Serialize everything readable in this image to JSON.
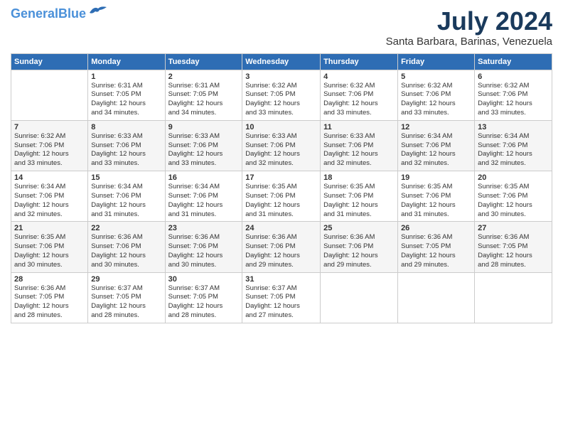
{
  "header": {
    "logo_general": "General",
    "logo_blue": "Blue",
    "month": "July 2024",
    "location": "Santa Barbara, Barinas, Venezuela"
  },
  "days_of_week": [
    "Sunday",
    "Monday",
    "Tuesday",
    "Wednesday",
    "Thursday",
    "Friday",
    "Saturday"
  ],
  "weeks": [
    [
      {
        "day": "",
        "info": ""
      },
      {
        "day": "1",
        "info": "Sunrise: 6:31 AM\nSunset: 7:05 PM\nDaylight: 12 hours\nand 34 minutes."
      },
      {
        "day": "2",
        "info": "Sunrise: 6:31 AM\nSunset: 7:05 PM\nDaylight: 12 hours\nand 34 minutes."
      },
      {
        "day": "3",
        "info": "Sunrise: 6:32 AM\nSunset: 7:05 PM\nDaylight: 12 hours\nand 33 minutes."
      },
      {
        "day": "4",
        "info": "Sunrise: 6:32 AM\nSunset: 7:06 PM\nDaylight: 12 hours\nand 33 minutes."
      },
      {
        "day": "5",
        "info": "Sunrise: 6:32 AM\nSunset: 7:06 PM\nDaylight: 12 hours\nand 33 minutes."
      },
      {
        "day": "6",
        "info": "Sunrise: 6:32 AM\nSunset: 7:06 PM\nDaylight: 12 hours\nand 33 minutes."
      }
    ],
    [
      {
        "day": "7",
        "info": "Sunrise: 6:32 AM\nSunset: 7:06 PM\nDaylight: 12 hours\nand 33 minutes."
      },
      {
        "day": "8",
        "info": "Sunrise: 6:33 AM\nSunset: 7:06 PM\nDaylight: 12 hours\nand 33 minutes."
      },
      {
        "day": "9",
        "info": "Sunrise: 6:33 AM\nSunset: 7:06 PM\nDaylight: 12 hours\nand 33 minutes."
      },
      {
        "day": "10",
        "info": "Sunrise: 6:33 AM\nSunset: 7:06 PM\nDaylight: 12 hours\nand 32 minutes."
      },
      {
        "day": "11",
        "info": "Sunrise: 6:33 AM\nSunset: 7:06 PM\nDaylight: 12 hours\nand 32 minutes."
      },
      {
        "day": "12",
        "info": "Sunrise: 6:34 AM\nSunset: 7:06 PM\nDaylight: 12 hours\nand 32 minutes."
      },
      {
        "day": "13",
        "info": "Sunrise: 6:34 AM\nSunset: 7:06 PM\nDaylight: 12 hours\nand 32 minutes."
      }
    ],
    [
      {
        "day": "14",
        "info": "Sunrise: 6:34 AM\nSunset: 7:06 PM\nDaylight: 12 hours\nand 32 minutes."
      },
      {
        "day": "15",
        "info": "Sunrise: 6:34 AM\nSunset: 7:06 PM\nDaylight: 12 hours\nand 31 minutes."
      },
      {
        "day": "16",
        "info": "Sunrise: 6:34 AM\nSunset: 7:06 PM\nDaylight: 12 hours\nand 31 minutes."
      },
      {
        "day": "17",
        "info": "Sunrise: 6:35 AM\nSunset: 7:06 PM\nDaylight: 12 hours\nand 31 minutes."
      },
      {
        "day": "18",
        "info": "Sunrise: 6:35 AM\nSunset: 7:06 PM\nDaylight: 12 hours\nand 31 minutes."
      },
      {
        "day": "19",
        "info": "Sunrise: 6:35 AM\nSunset: 7:06 PM\nDaylight: 12 hours\nand 31 minutes."
      },
      {
        "day": "20",
        "info": "Sunrise: 6:35 AM\nSunset: 7:06 PM\nDaylight: 12 hours\nand 30 minutes."
      }
    ],
    [
      {
        "day": "21",
        "info": "Sunrise: 6:35 AM\nSunset: 7:06 PM\nDaylight: 12 hours\nand 30 minutes."
      },
      {
        "day": "22",
        "info": "Sunrise: 6:36 AM\nSunset: 7:06 PM\nDaylight: 12 hours\nand 30 minutes."
      },
      {
        "day": "23",
        "info": "Sunrise: 6:36 AM\nSunset: 7:06 PM\nDaylight: 12 hours\nand 30 minutes."
      },
      {
        "day": "24",
        "info": "Sunrise: 6:36 AM\nSunset: 7:06 PM\nDaylight: 12 hours\nand 29 minutes."
      },
      {
        "day": "25",
        "info": "Sunrise: 6:36 AM\nSunset: 7:06 PM\nDaylight: 12 hours\nand 29 minutes."
      },
      {
        "day": "26",
        "info": "Sunrise: 6:36 AM\nSunset: 7:05 PM\nDaylight: 12 hours\nand 29 minutes."
      },
      {
        "day": "27",
        "info": "Sunrise: 6:36 AM\nSunset: 7:05 PM\nDaylight: 12 hours\nand 28 minutes."
      }
    ],
    [
      {
        "day": "28",
        "info": "Sunrise: 6:36 AM\nSunset: 7:05 PM\nDaylight: 12 hours\nand 28 minutes."
      },
      {
        "day": "29",
        "info": "Sunrise: 6:37 AM\nSunset: 7:05 PM\nDaylight: 12 hours\nand 28 minutes."
      },
      {
        "day": "30",
        "info": "Sunrise: 6:37 AM\nSunset: 7:05 PM\nDaylight: 12 hours\nand 28 minutes."
      },
      {
        "day": "31",
        "info": "Sunrise: 6:37 AM\nSunset: 7:05 PM\nDaylight: 12 hours\nand 27 minutes."
      },
      {
        "day": "",
        "info": ""
      },
      {
        "day": "",
        "info": ""
      },
      {
        "day": "",
        "info": ""
      }
    ]
  ]
}
